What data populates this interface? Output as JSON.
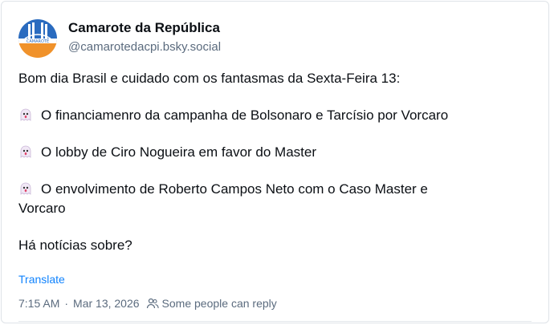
{
  "author": {
    "display_name": "Camarote da República",
    "handle": "@camarotedacpi.bsky.social",
    "avatar_text": "CAMAROTE"
  },
  "post": {
    "lines": [
      "Bom dia Brasil e cuidado com os fantasmas da Sexta-Feira 13:",
      "O financiamenro da campanha de Bolsonaro e Tarcísio por Vorcaro",
      "O lobby de Ciro Nogueira em favor do Master",
      "O envolvimento de Roberto Campos Neto com o Caso Master e",
      "Vorcaro",
      "Há notícias sobre?"
    ]
  },
  "actions": {
    "translate_label": "Translate"
  },
  "meta": {
    "time": "7:15 AM",
    "separator": "·",
    "date": "Mar 13, 2026",
    "reply_setting": "Some people can reply"
  },
  "colors": {
    "avatar_top": "#2a6bbf",
    "avatar_bottom": "#f0922b",
    "link": "#1083fe",
    "muted": "#5b6b7e"
  }
}
